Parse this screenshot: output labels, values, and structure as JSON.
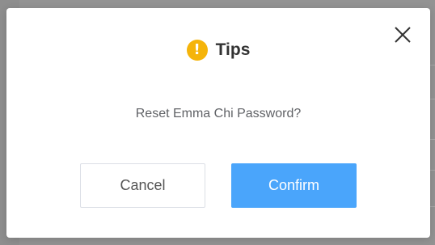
{
  "dialog": {
    "title": "Tips",
    "title_icon": "exclamation-circle-icon",
    "message": "Reset Emma Chi Password?",
    "close_icon": "close-icon",
    "cancel_label": "Cancel",
    "confirm_label": "Confirm"
  },
  "colors": {
    "accent": "#4aa5fb",
    "warning": "#f5b40a",
    "overlay": "#8e8e8e"
  }
}
